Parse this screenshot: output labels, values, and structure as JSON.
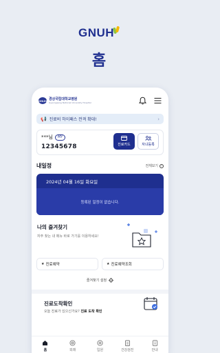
{
  "brand": {
    "name": "GNUH",
    "screen_title": "홈"
  },
  "app": {
    "hospital_name": "경상국립대학교병원",
    "hospital_sub": "Gyeongsang National University Hospital",
    "hospital_emblem": "GNUH",
    "icons": [
      "bell-icon",
      "menu-icon"
    ]
  },
  "notice": {
    "text": "진료비 하이패스 전격 확대!"
  },
  "patient": {
    "name": "***님",
    "badge": "MY",
    "number": "12345678",
    "buttons": {
      "card": "진료카드",
      "register": "자녀등록"
    }
  },
  "schedule": {
    "title": "내일정",
    "more": "전체보기",
    "date": "2024년 04월 16일 화요일",
    "empty_text": "등록된 일정이 없습니다."
  },
  "favorites": {
    "title": "나의 즐겨찾기",
    "desc": "자주 찾는 내 메뉴 바로 가기를 이용하세요!",
    "items": [
      "진료예약",
      "진료예약조회"
    ],
    "setting": "즐겨찾기 설정"
  },
  "checkin": {
    "title": "진료도착확인",
    "desc_prefix": "오늘 진료가 있으신가요? ",
    "desc_bold": "진료 도착 확인"
  },
  "tabbar": {
    "items": [
      {
        "label": "홈",
        "icon": "home-icon",
        "active": true
      },
      {
        "label": "외래",
        "icon": "outpatient-icon",
        "active": false
      },
      {
        "label": "입원",
        "icon": "inpatient-icon",
        "active": false
      },
      {
        "label": "건강검진",
        "icon": "checkup-icon",
        "active": false
      },
      {
        "label": "안내",
        "icon": "info-icon",
        "active": false
      }
    ]
  },
  "colors": {
    "primary": "#1f2f8f",
    "accent_green": "#8cc63f",
    "accent_yellow": "#f5b700",
    "background": "#e9edf3"
  }
}
